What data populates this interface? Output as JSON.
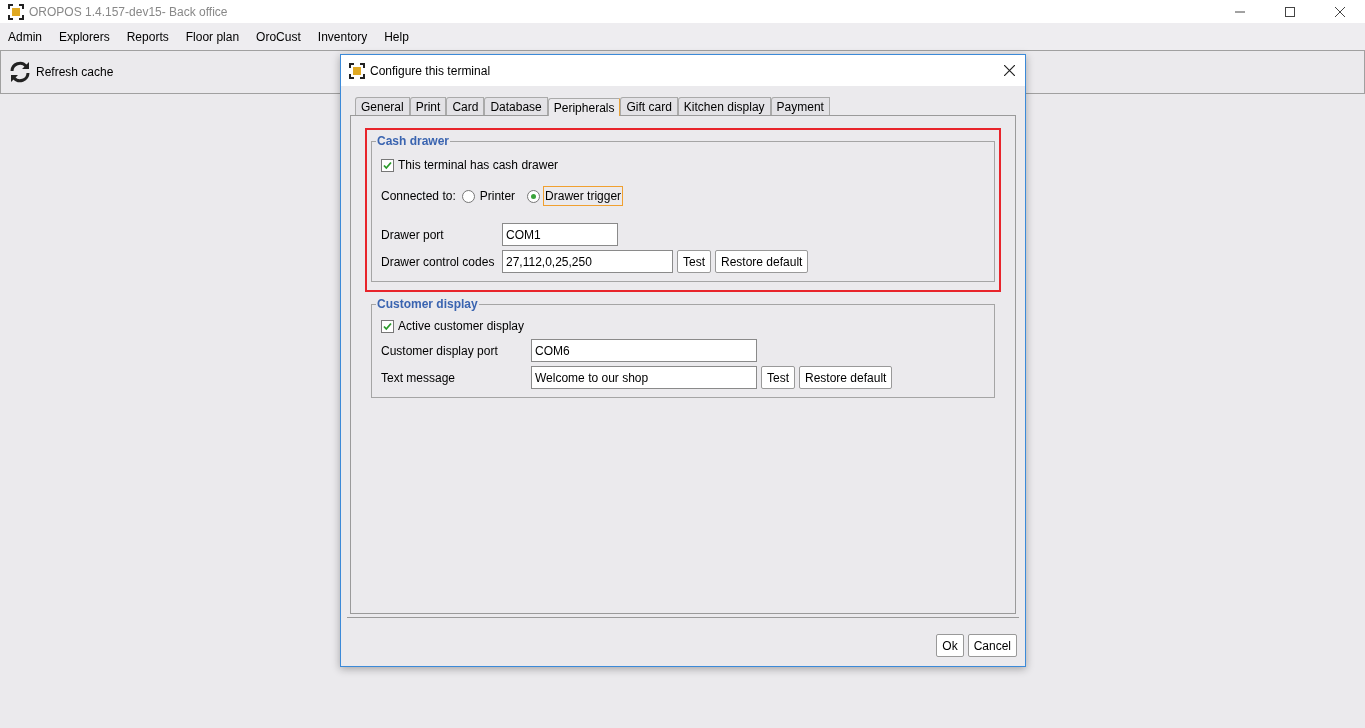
{
  "window": {
    "title": "OROPOS 1.4.157-dev15- Back office"
  },
  "menu": [
    "Admin",
    "Explorers",
    "Reports",
    "Floor plan",
    "OroCust",
    "Inventory",
    "Help"
  ],
  "toolbar": {
    "refresh_label": "Refresh cache"
  },
  "dialog": {
    "title": "Configure this terminal",
    "tabs": [
      {
        "label": "General",
        "selected": false
      },
      {
        "label": "Print",
        "selected": false
      },
      {
        "label": "Card",
        "selected": false
      },
      {
        "label": "Database",
        "selected": false
      },
      {
        "label": "Peripherals",
        "selected": true
      },
      {
        "label": "Gift card",
        "selected": false
      },
      {
        "label": "Kitchen display",
        "selected": false
      },
      {
        "label": "Payment",
        "selected": false
      }
    ],
    "cash_drawer": {
      "title": "Cash drawer",
      "highlighted": true,
      "checkbox": {
        "label": "This terminal has cash drawer",
        "checked": true
      },
      "connected_to": {
        "label": "Connected to:",
        "options": [
          {
            "label": "Printer",
            "selected": false,
            "focused": false
          },
          {
            "label": "Drawer trigger",
            "selected": true,
            "focused": true
          }
        ]
      },
      "port": {
        "label": "Drawer port",
        "value": "COM1"
      },
      "codes": {
        "label": "Drawer control codes",
        "value": "27,112,0,25,250",
        "buttons": [
          "Test",
          "Restore default"
        ]
      }
    },
    "customer_display": {
      "title": "Customer display",
      "highlighted": false,
      "checkbox": {
        "label": "Active customer display",
        "checked": true
      },
      "port": {
        "label": "Customer display port",
        "value": "COM6"
      },
      "message": {
        "label": "Text message",
        "value": "Welcome to our shop",
        "buttons": [
          "Test",
          "Restore default"
        ]
      }
    },
    "buttons": [
      "Ok",
      "Cancel"
    ]
  }
}
